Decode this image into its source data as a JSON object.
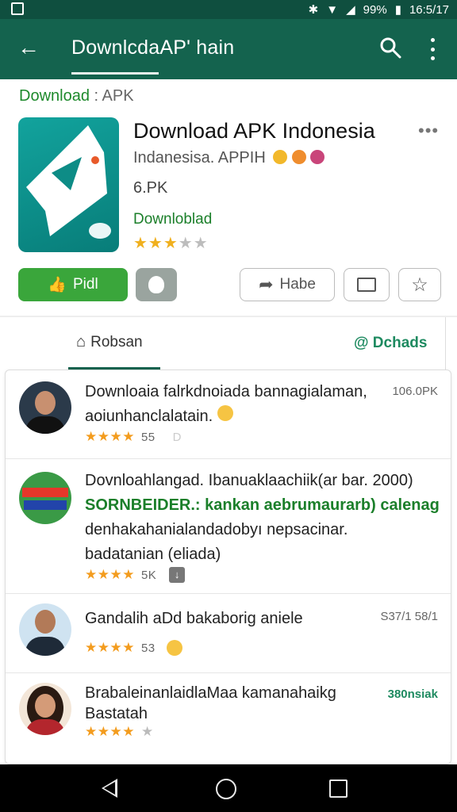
{
  "status_bar": {
    "battery": "99%",
    "time": "16:5/17"
  },
  "toolbar": {
    "title": "DownlcdaAP' hain"
  },
  "breadcrumb": {
    "primary": "Download",
    "separator": ":",
    "secondary": "APK"
  },
  "app": {
    "title": "Download APK Indonesia",
    "developer": "Indanesisa. APPIH",
    "size": "6.PK",
    "category": "Downloblad",
    "rating": 3,
    "rating_max": 5
  },
  "buttons": {
    "install": "Pidl",
    "share": "Habe"
  },
  "tabs": {
    "home": "Robsan",
    "downloads": "@ Dchads"
  },
  "reviews": [
    {
      "lines": [
        "Downloaia falrkdnoiada bannagialaman,",
        "aoiunhanclalatain."
      ],
      "meta": "106.0PK",
      "stars": 4,
      "count": "55",
      "extra": "D"
    },
    {
      "lines": [
        "Dovnloahlangad. Ibanuaklaachiik(ar bar. 2000)",
        "SORNBEIDER.: kankan aebrumaurarb) calenag",
        "denhakahanialandadobyı nepsacinar.",
        "badatanian (eliada)"
      ],
      "meta": "",
      "stars": 4,
      "count": "5K"
    },
    {
      "lines": [
        "Gandalih aDd bakaborig aniele"
      ],
      "meta": "S37/1 58/1",
      "stars": 4,
      "count": "53"
    },
    {
      "lines": [
        "BrabaleinanlaidlaMaa kamanahaikg",
        "Bastatah"
      ],
      "meta": "380nsiak",
      "stars": 4,
      "count": ""
    }
  ],
  "colors": {
    "toolbar": "#14634e",
    "status_bar": "#0f4f3f",
    "accent_green": "#3aa63b",
    "star": "#f0b01e"
  }
}
